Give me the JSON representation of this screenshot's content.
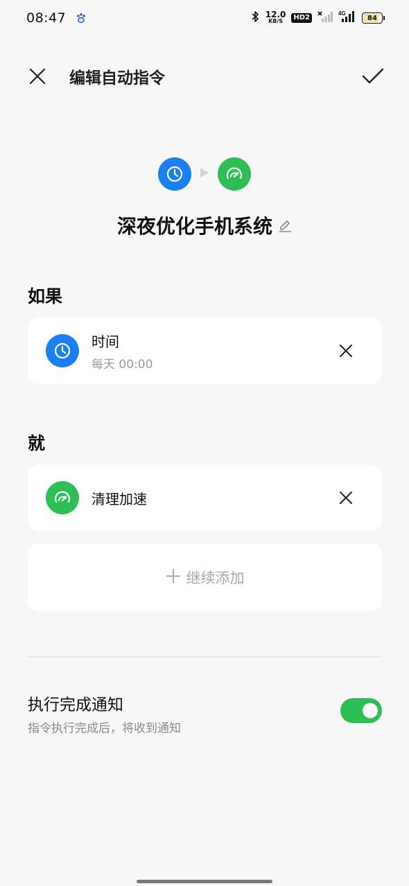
{
  "status_bar": {
    "time": "08:47",
    "net_speed_value": "12.0",
    "net_speed_unit": "KB/S",
    "hd_label": "HD2",
    "battery": "84",
    "battery_level": 0.84,
    "icons": [
      "baidu-paw-icon",
      "bluetooth-icon",
      "signal-off-icon",
      "signal-4g-icon"
    ]
  },
  "header": {
    "title": "编辑自动指令"
  },
  "hero": {
    "title": "深夜优化手机系统"
  },
  "if_section": {
    "label": "如果",
    "condition": {
      "title": "时间",
      "subtitle": "每天 00:00",
      "icon": "clock-icon"
    }
  },
  "then_section": {
    "label": "就",
    "action": {
      "title": "清理加速",
      "icon": "speedometer-icon"
    },
    "add_label": "继续添加"
  },
  "notification": {
    "title": "执行完成通知",
    "subtitle": "指令执行完成后，将收到通知",
    "enabled": true
  },
  "colors": {
    "blue": "#1a7ff0",
    "green": "#2dbf55",
    "background": "#f7f7f7"
  }
}
